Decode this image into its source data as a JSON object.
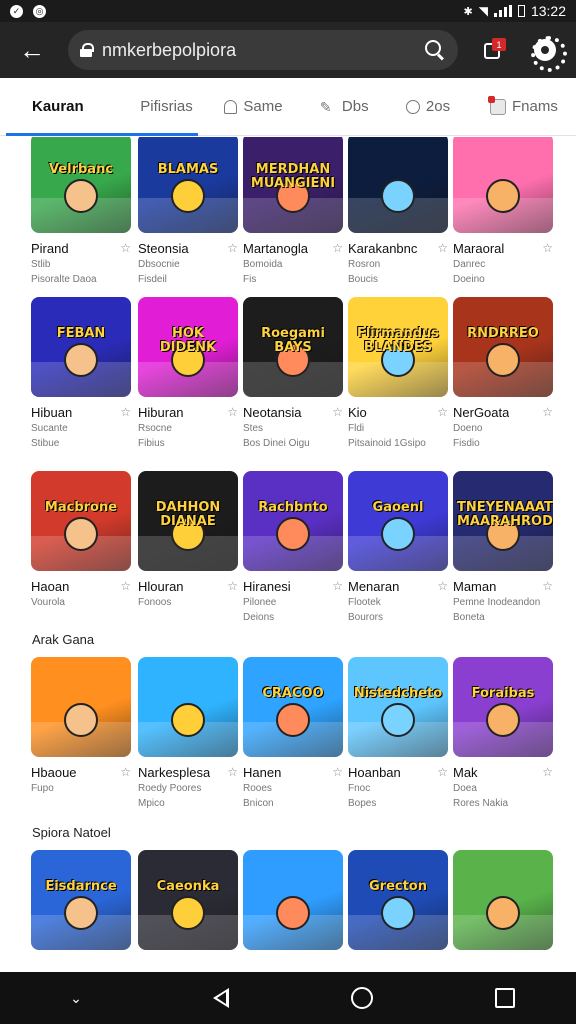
{
  "status": {
    "time": "13:22"
  },
  "browser": {
    "url": "nmkerbepolpiora",
    "tab_count": "1"
  },
  "tabs": [
    {
      "label": "Kauran",
      "icon": ""
    },
    {
      "label": "Pifisrias",
      "icon": ""
    },
    {
      "label": "Same",
      "icon": "bell-icon"
    },
    {
      "label": "Dbs",
      "icon": "pen-icon"
    },
    {
      "label": "2os",
      "icon": "shield-icon"
    },
    {
      "label": "Fnams",
      "icon": "app-icon"
    }
  ],
  "colors": {
    "accent": "#1a73e8",
    "topbar": "#252525",
    "card_bg": [
      "#37a84b",
      "#1a3a9e",
      "#3b1f6b",
      "#0d1d3d",
      "#ff6fae",
      "#2a2bb8",
      "#e11ed6",
      "#1d1d1d",
      "#ffd23a",
      "#a8341c",
      "#d23a2b",
      "#1c1c1c",
      "#5a2fc4",
      "#3d3ad6",
      "#262a70",
      "#ff8f1f",
      "#2fb3ff",
      "#2ea3ff",
      "#5ec6ff",
      "#8a3fd1",
      "#2a66d8",
      "#2b2b35",
      "#2f9dff",
      "#1e4bb5",
      "#59b34a"
    ]
  },
  "sections": {
    "row4_title": "Arak Gana",
    "row5_title": "Spiora Natoel"
  },
  "games": [
    {
      "thumb": "Velrbanc",
      "name": "Pirand",
      "sub1": "Stlib",
      "sub2": "Pisoralte Daoa"
    },
    {
      "thumb": "BLAMAS",
      "name": "Steonsia",
      "sub1": "Dbsocnie",
      "sub2": "Fisdeil"
    },
    {
      "thumb": "MERDHAN MUANGIENI",
      "name": "Martanogla",
      "sub1": "Bomoida",
      "sub2": "Fis"
    },
    {
      "thumb": "",
      "name": "Karakanbnc",
      "sub1": "Rosron",
      "sub2": "Boucis"
    },
    {
      "thumb": "",
      "name": "Maraoral",
      "sub1": "Danrec",
      "sub2": "Doeino"
    },
    {
      "thumb": "FEBAN",
      "name": "Hibuan",
      "sub1": "Sucante",
      "sub2": "Stibue"
    },
    {
      "thumb": "HOK DIDENK",
      "name": "Hiburan",
      "sub1": "Rsocne",
      "sub2": "Fibius"
    },
    {
      "thumb": "Roegami BAYS",
      "name": "Neotansia",
      "sub1": "Stes",
      "sub2": "Bos Dinei Oigu"
    },
    {
      "thumb": "Flirmandus BLANDES",
      "name": "Kio",
      "sub1": "Fldi",
      "sub2": "Pitsainoid 1Gsipo"
    },
    {
      "thumb": "RNDRREO",
      "name": "NerGoata",
      "sub1": "Doeno",
      "sub2": "Fisdio"
    },
    {
      "thumb": "Macbrone",
      "name": "Haoan",
      "sub1": "Vourola",
      "sub2": ""
    },
    {
      "thumb": "DAHHON DIANAE",
      "name": "Hlouran",
      "sub1": "Fonoos",
      "sub2": ""
    },
    {
      "thumb": "Rachbnto",
      "name": "Hiranesi",
      "sub1": "Pilonee",
      "sub2": "Deions"
    },
    {
      "thumb": "Gaoenl",
      "name": "Menaran",
      "sub1": "Flootek",
      "sub2": "Bourors"
    },
    {
      "thumb": "TNEYENAAAT MAARAHRODI",
      "name": "Maman",
      "sub1": "Pemne Inodeandon",
      "sub2": "Boneta"
    },
    {
      "thumb": "",
      "name": "Hbaoue",
      "sub1": "Fupo",
      "sub2": ""
    },
    {
      "thumb": "",
      "name": "Narkesplesa",
      "sub1": "Roedy Poores",
      "sub2": "Mpico"
    },
    {
      "thumb": "CRACOO",
      "name": "Hanen",
      "sub1": "Rooes",
      "sub2": "Bnicon"
    },
    {
      "thumb": "Nistedcheto",
      "name": "Hoanban",
      "sub1": "Fnoc",
      "sub2": "Bopes"
    },
    {
      "thumb": "Foraibas",
      "name": "Mak",
      "sub1": "Doea",
      "sub2": "Rores Nakia"
    },
    {
      "thumb": "Eisdarnce",
      "name": "",
      "sub1": "",
      "sub2": ""
    },
    {
      "thumb": "Caeonka",
      "name": "",
      "sub1": "",
      "sub2": ""
    },
    {
      "thumb": "",
      "name": "",
      "sub1": "",
      "sub2": ""
    },
    {
      "thumb": "Grecton",
      "name": "",
      "sub1": "",
      "sub2": ""
    },
    {
      "thumb": "",
      "name": "",
      "sub1": "",
      "sub2": ""
    }
  ]
}
